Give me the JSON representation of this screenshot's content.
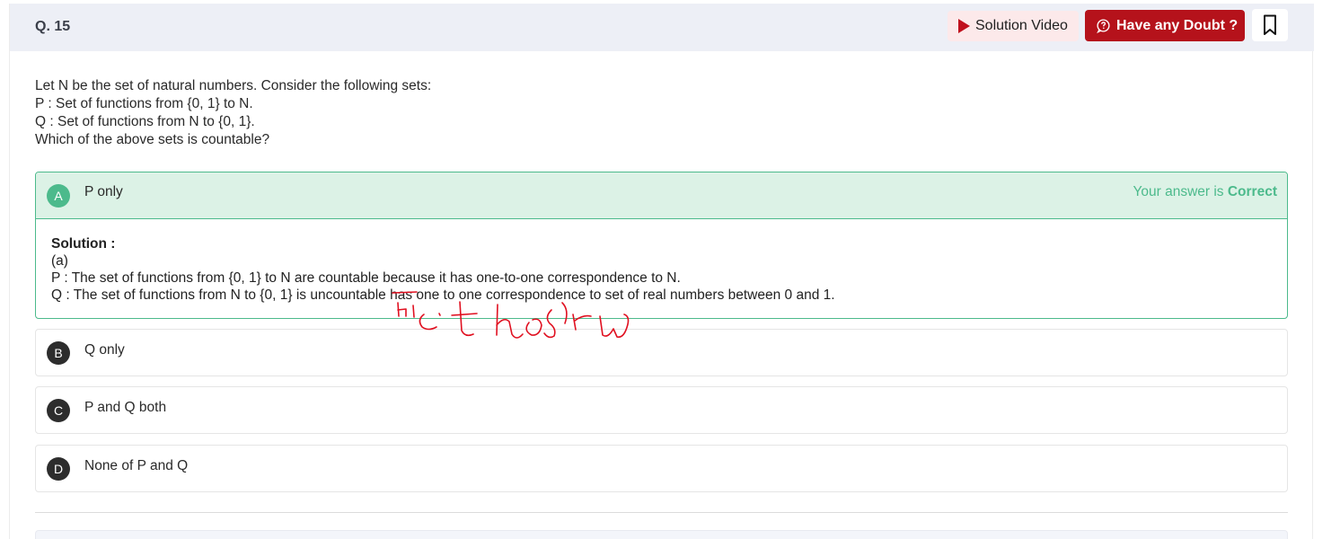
{
  "question_number": "Q. 15",
  "header_buttons": {
    "solution_video": "Solution Video",
    "have_doubt": "Have any Doubt ?"
  },
  "question_lines": [
    "Let N be the set of natural numbers. Consider the following sets:",
    "P : Set of functions from {0, 1} to N.",
    "Q : Set of functions from N to {0, 1}.",
    "Which of the above sets is countable?"
  ],
  "options": [
    {
      "letter": "A",
      "text": "P only",
      "state": "correct"
    },
    {
      "letter": "B",
      "text": "Q only"
    },
    {
      "letter": "C",
      "text": "P and Q both"
    },
    {
      "letter": "D",
      "text": "None of P and Q"
    }
  ],
  "verdict": {
    "prefix": "Your answer is ",
    "status": "Correct"
  },
  "solution": {
    "title": "Solution :",
    "lines": [
      "(a)",
      "P : The set of functions from {0, 1} to N are countable because it has one-to-one correspondence to N.",
      "Q : The set of functions from N to {0, 1} is uncountable has one to one correspondence to set of real numbers between 0 and 1."
    ]
  },
  "colors": {
    "brand_red": "#b5121b",
    "correct_green": "#4cba8c",
    "correct_bg": "#dcf2e6",
    "header_bg": "#edeff6",
    "ink_red": "#e01020"
  },
  "icons": {
    "video": "play-icon",
    "doubt": "question-bubble-icon",
    "bookmark": "bookmark-icon"
  }
}
